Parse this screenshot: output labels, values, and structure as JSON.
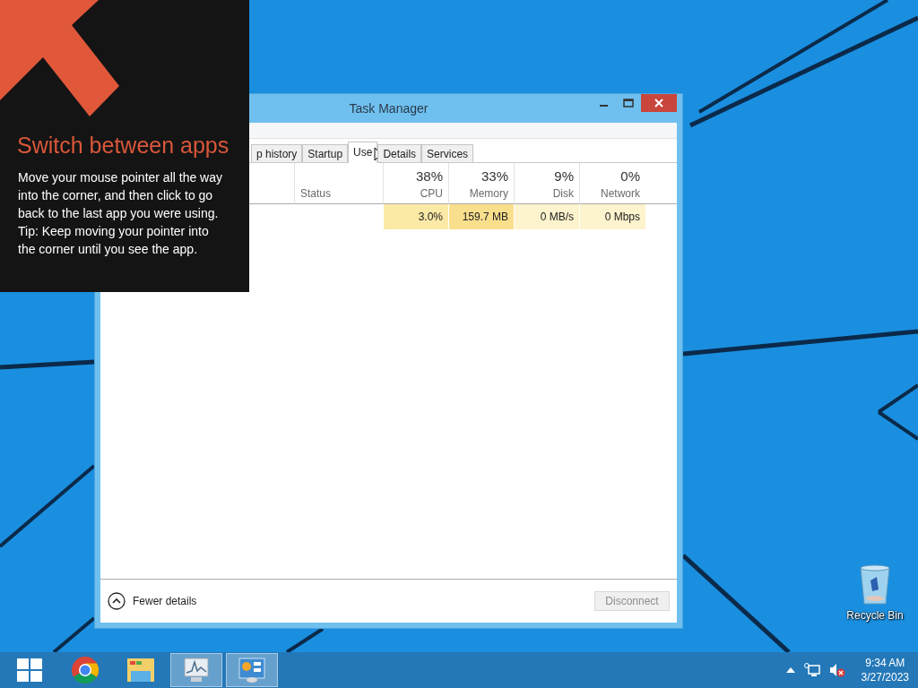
{
  "window": {
    "title": "Task Manager"
  },
  "tabs": [
    {
      "label": "p history",
      "selected": false
    },
    {
      "label": "Startup",
      "selected": false
    },
    {
      "label": "Use",
      "selected": true
    },
    {
      "label": "Details",
      "selected": false
    },
    {
      "label": "Services",
      "selected": false
    }
  ],
  "table": {
    "columns": [
      {
        "label": "Status"
      },
      {
        "label": "CPU",
        "percent": "38%"
      },
      {
        "label": "Memory",
        "percent": "33%"
      },
      {
        "label": "Disk",
        "percent": "9%"
      },
      {
        "label": "Network",
        "percent": "0%"
      }
    ],
    "rows": [
      {
        "cells": [
          {
            "text": ""
          },
          {
            "text": "3.0%",
            "color": "#fbe9a6"
          },
          {
            "text": "159.7 MB",
            "color": "#f9df8c"
          },
          {
            "text": "0 MB/s",
            "color": "#fdf3cc"
          },
          {
            "text": "0 Mbps",
            "color": "#fdf3cc"
          }
        ]
      }
    ]
  },
  "footer": {
    "toggle": "Fewer details",
    "button": {
      "label": "Disconnect",
      "disabled": true
    }
  },
  "tip": {
    "title": "Switch between apps",
    "body": "Move your mouse pointer all the way into the corner, and then click to go back to the last app you were using.\nTip: Keep moving your pointer into the corner until you see the app."
  },
  "desktop_icons": [
    {
      "label": "Recycle Bin"
    }
  ],
  "taskbar": {
    "apps": [
      {
        "kind": "chrome",
        "active": false
      },
      {
        "kind": "explorer",
        "active": false
      },
      {
        "kind": "taskmgr",
        "active": true
      },
      {
        "kind": "control",
        "active": true
      }
    ],
    "clock": {
      "time": "9:34 AM",
      "date": "3/27/2023"
    }
  }
}
